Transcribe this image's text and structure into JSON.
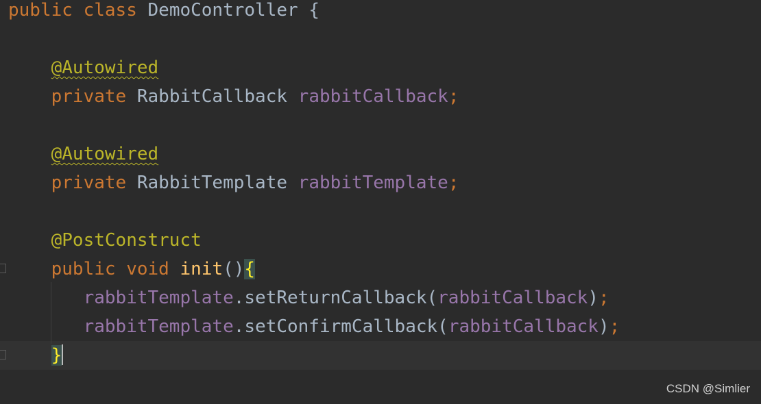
{
  "editor": {
    "line1": {
      "kw1": "public",
      "kw2": "class",
      "cls": "DemoController",
      "brace": "{"
    },
    "line3": {
      "ann": "@Autowired"
    },
    "line4": {
      "kw": "private",
      "type": "RabbitCallback",
      "field": "rabbitCallback",
      "semi": ";"
    },
    "line6": {
      "ann": "@Autowired"
    },
    "line7": {
      "kw": "private",
      "type": "RabbitTemplate",
      "field": "rabbitTemplate",
      "semi": ";"
    },
    "line9": {
      "ann": "@PostConstruct"
    },
    "line10": {
      "kw1": "public",
      "kw2": "void",
      "method": "init",
      "parens": "()",
      "brace": "{"
    },
    "line11": {
      "obj": "rabbitTemplate",
      "dot": ".",
      "call": "setReturnCallback(",
      "arg": "rabbitCallback",
      "close": ")",
      "semi": ";"
    },
    "line12": {
      "obj": "rabbitTemplate",
      "dot": ".",
      "call": "setConfirmCallback(",
      "arg": "rabbitCallback",
      "close": ")",
      "semi": ";"
    },
    "line13": {
      "brace": "}"
    }
  },
  "watermark": "CSDN @Simlier",
  "colors": {
    "background": "#2b2b2b",
    "keyword": "#cc7832",
    "field": "#9876aa",
    "annotation": "#bbb529",
    "method": "#ffc66d",
    "plain": "#a9b7c6"
  }
}
